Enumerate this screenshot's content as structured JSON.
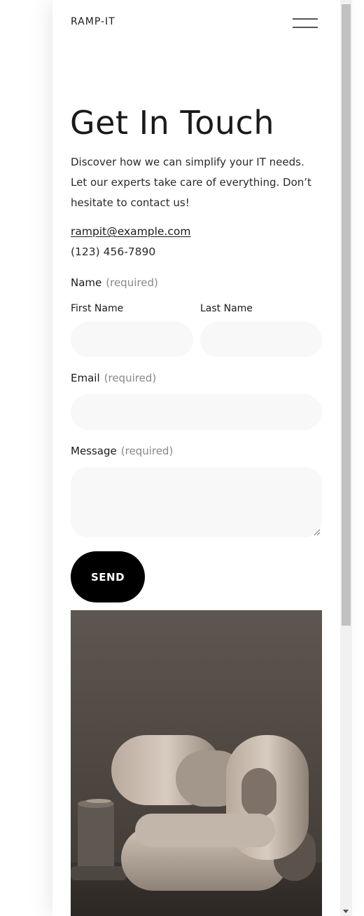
{
  "header": {
    "logo": "RAMP-IT",
    "menu_icon": "hamburger-menu-icon"
  },
  "contact": {
    "title": "Get In Touch",
    "intro": "Discover how we can simplify your IT needs. Let our experts take care of everything. Don’t hesitate to contact us!",
    "email": "rampit@example.com",
    "phone": "(123) 456-7890"
  },
  "form": {
    "name_label": "Name",
    "required_text": "(required)",
    "first_name_label": "First Name",
    "last_name_label": "Last Name",
    "first_name_value": "",
    "last_name_value": "",
    "email_label": "Email",
    "email_value": "",
    "message_label": "Message",
    "message_value": "",
    "send_label": "SEND"
  },
  "colors": {
    "field_bg": "#f8f8f8",
    "button_bg": "#000000",
    "button_text": "#ffffff",
    "required_text": "#888888"
  }
}
